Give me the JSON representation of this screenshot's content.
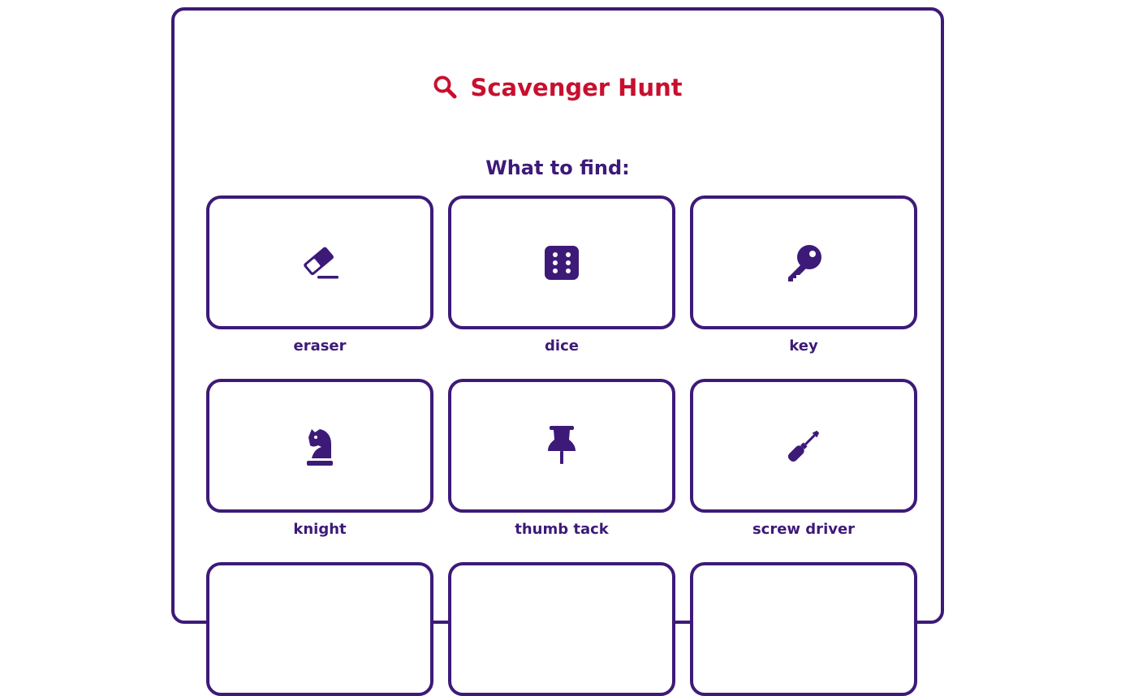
{
  "header": {
    "title": "Scavenger Hunt",
    "title_icon": "search-icon",
    "subtitle": "What to find:"
  },
  "colors": {
    "title": "#c8102e",
    "accent": "#3d1a78"
  },
  "items": [
    {
      "label": "eraser",
      "icon": "eraser-icon"
    },
    {
      "label": "dice",
      "icon": "dice-icon"
    },
    {
      "label": "key",
      "icon": "key-icon"
    },
    {
      "label": "knight",
      "icon": "chess-knight-icon"
    },
    {
      "label": "thumb tack",
      "icon": "thumbtack-icon"
    },
    {
      "label": "screw driver",
      "icon": "screwdriver-icon"
    }
  ]
}
